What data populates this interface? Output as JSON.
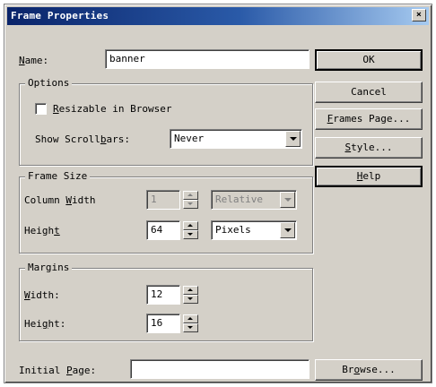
{
  "window": {
    "title": "Frame Properties",
    "close_glyph": "×"
  },
  "name_field": {
    "label_accel": "N",
    "label_rest": "ame:",
    "value": "banner"
  },
  "options_group": {
    "title": "Options",
    "resizable_accel": "R",
    "resizable_rest": "esizable in Browser",
    "resizable_checked": false,
    "scrollbars_label_pre": "Show Scroll",
    "scrollbars_accel": "b",
    "scrollbars_label_post": "ars:",
    "scrollbars_value": "Never"
  },
  "frame_size_group": {
    "title": "Frame Size",
    "column_width_pre": "Column ",
    "column_width_accel": "W",
    "column_width_post": "idth",
    "column_width_value": "1",
    "column_width_unit": "Relative",
    "height_pre": "Heigh",
    "height_accel": "t",
    "height_value": "64",
    "height_unit": "Pixels"
  },
  "margins_group": {
    "title": "Margins",
    "width_accel": "W",
    "width_rest": "idth:",
    "width_value": "12",
    "height_pre": "Hei",
    "height_accel": "g",
    "height_post": "ht:",
    "height_value": "16"
  },
  "initial_page": {
    "pre": "Initial ",
    "accel": "P",
    "post": "age:",
    "value": ""
  },
  "buttons": {
    "ok": "OK",
    "cancel": "Cancel",
    "frames_page_accel": "F",
    "frames_page_rest": "rames Page...",
    "style_accel": "S",
    "style_rest": "tyle...",
    "help_accel": "H",
    "help_rest": "elp",
    "browse_pre": "Br",
    "browse_accel": "o",
    "browse_post": "wse..."
  }
}
